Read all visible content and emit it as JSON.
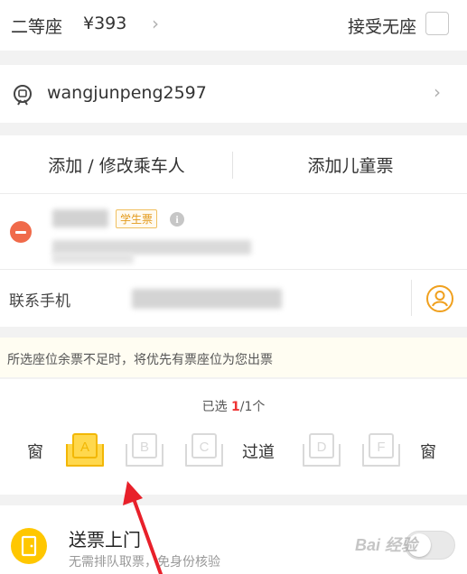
{
  "seat_bar": {
    "seat_class": "二等座",
    "price": "¥393",
    "accept_no_seat_label": "接受无座"
  },
  "account": {
    "username": "wangjunpeng2597"
  },
  "passenger_actions": {
    "add_modify_label": "添加 / 修改乘车人",
    "add_child_label": "添加儿童票"
  },
  "passenger": {
    "ticket_type_tag": "学生票"
  },
  "contact": {
    "label": "联系手机"
  },
  "notice": {
    "text": "所选座位余票不足时，将优先有票座位为您出票"
  },
  "seat_selection": {
    "selected_prefix": "已选 ",
    "selected_count": "1",
    "selected_suffix": "/1个",
    "window_label_left": "窗",
    "aisle_label": "过道",
    "window_label_right": "窗",
    "seats": [
      {
        "letter": "A",
        "selected": true
      },
      {
        "letter": "B",
        "selected": false
      },
      {
        "letter": "C",
        "selected": false
      },
      {
        "letter": "D",
        "selected": false
      },
      {
        "letter": "F",
        "selected": false
      }
    ]
  },
  "delivery": {
    "title": "送票上门",
    "subtitle": "无需排队取票，免身份核验"
  },
  "watermark": {
    "text": "Bai 经验"
  },
  "colors": {
    "seat_selected_fill": "#ffd84d",
    "seat_selected_stroke": "#f2b705",
    "seat_unselected_stroke": "#d9d9d9",
    "accent_orange": "#f0a01e",
    "remove_red": "#f06a4a",
    "delivery_yellow": "#ffc700",
    "annotation_arrow": "#e8202a"
  }
}
